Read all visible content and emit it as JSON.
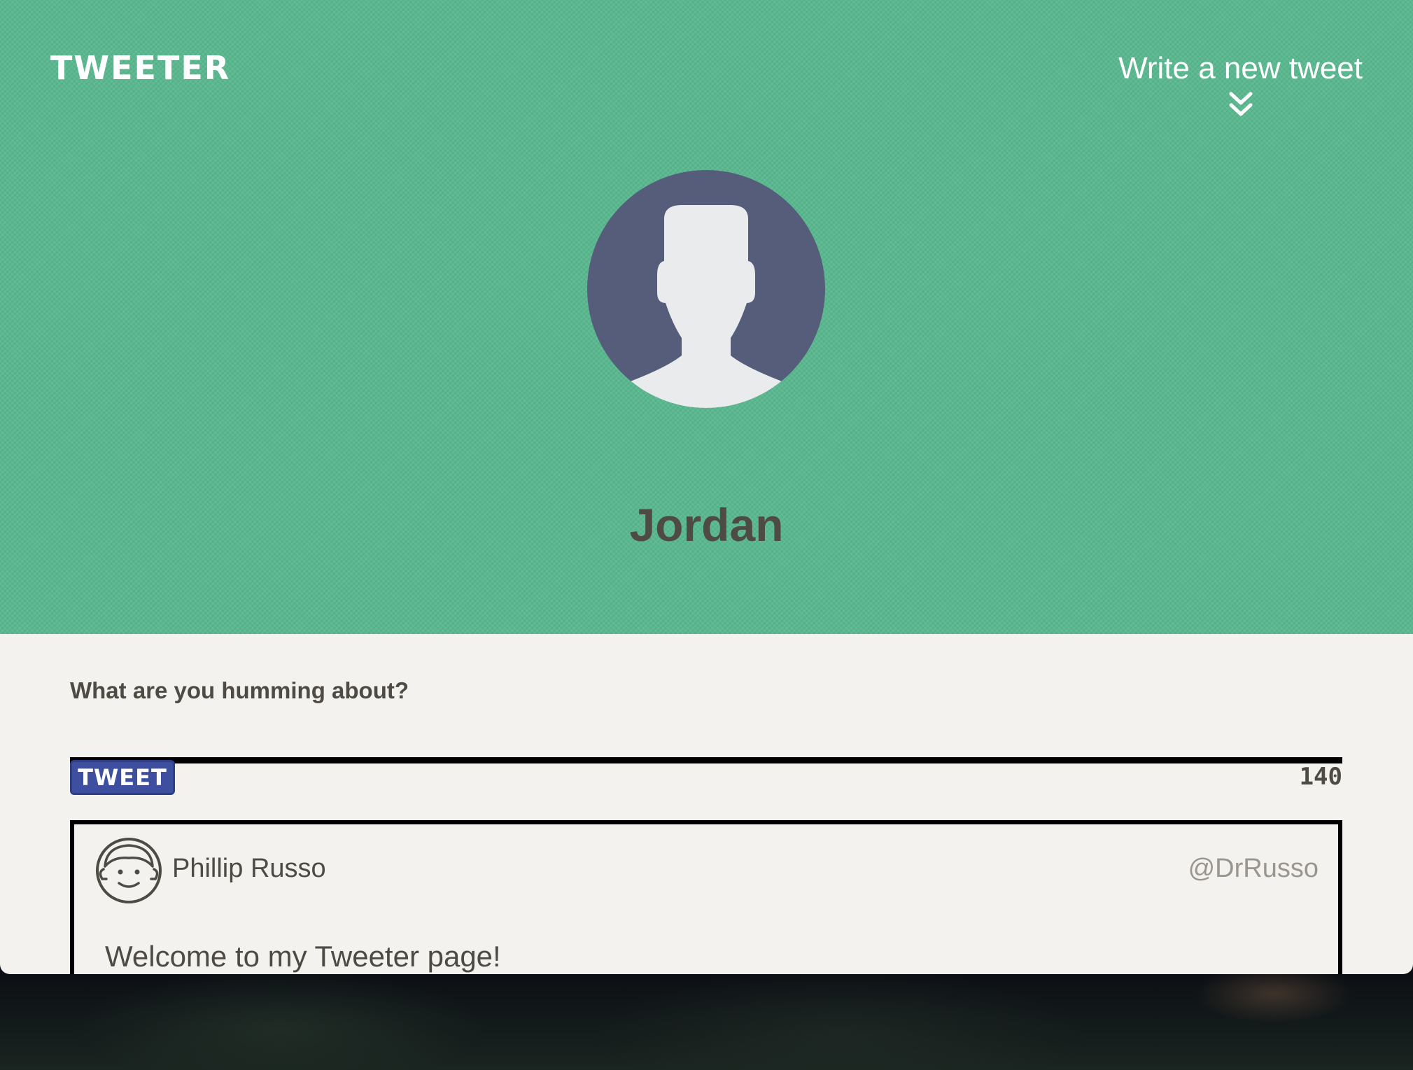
{
  "app": {
    "logo": "TWEETER",
    "write_link": "Write a new tweet",
    "write_icon": "double-chevron-down-icon"
  },
  "profile": {
    "name": "Jordan",
    "avatar_icon": "user-silhouette-icon"
  },
  "compose": {
    "label": "What are you humming about?",
    "input_value": "",
    "button_label": "TWEET",
    "char_counter": "140"
  },
  "tweets": [
    {
      "author": "Phillip Russo",
      "handle": "@DrRusso",
      "avatar_icon": "cartoon-face-icon",
      "content": "Welcome to my Tweeter page!"
    }
  ],
  "colors": {
    "header_bg": "#5ab88f",
    "page_bg": "#f4f2ee",
    "text_dark": "#4e4b45",
    "button_bg": "#3d4f9e",
    "avatar_circle": "#555d7a",
    "avatar_silhouette": "#e9ebec"
  }
}
